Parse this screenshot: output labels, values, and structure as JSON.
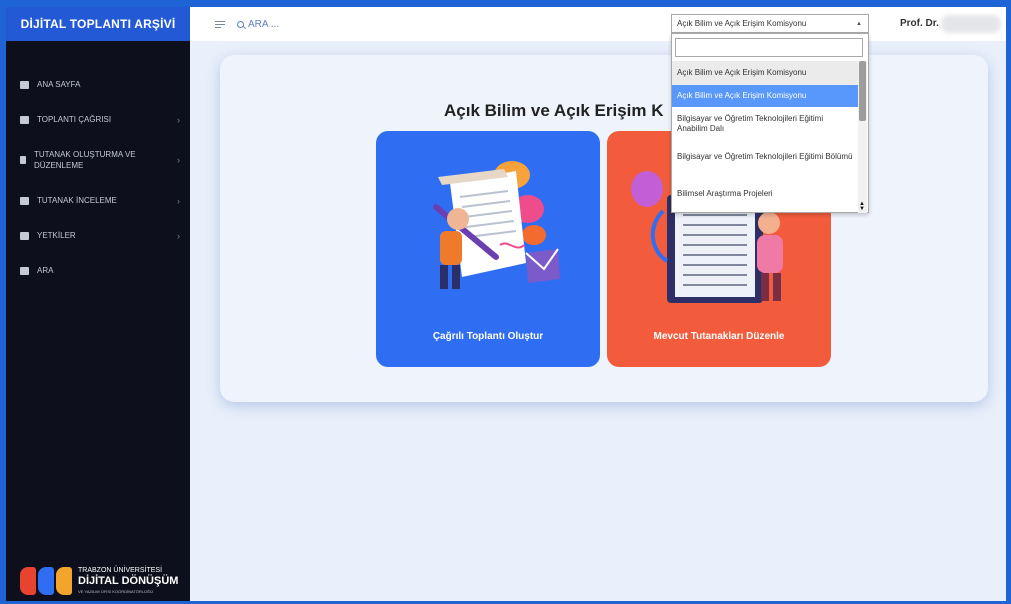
{
  "sidebar": {
    "brand": "DİJİTAL TOPLANTI ARŞİVİ",
    "items": [
      {
        "label": "ANA SAYFA",
        "icon": "dashboard-icon",
        "chevron": ""
      },
      {
        "label": "TOPLANTI ÇAĞRISI",
        "icon": "calendar-icon",
        "chevron": "›"
      },
      {
        "label": "TUTANAK OLUŞTURMA VE DÜZENLEME",
        "icon": "edit-icon",
        "chevron": "›"
      },
      {
        "label": "TUTANAK İNCELEME",
        "icon": "document-icon",
        "chevron": "›"
      },
      {
        "label": "YETKİLER",
        "icon": "id-card-icon",
        "chevron": "›"
      },
      {
        "label": "ARA",
        "icon": "search-list-icon",
        "chevron": ""
      }
    ],
    "logo": {
      "line1": "TRABZON ÜNİVERSİTESİ",
      "line2": "DİJİTAL DÖNÜŞÜM",
      "line3": "VE YAZILIM OFİSİ KOORDİNATÖRLÜĞÜ"
    }
  },
  "topbar": {
    "search_label": "ARA ...",
    "select_value": "Açık Bilim ve Açık Erişim Komisyonu",
    "select_arrow": "▲",
    "profile": "Prof. Dr."
  },
  "dropdown": {
    "options": [
      "Açık Bilim ve Açık Erişim Komisyonu",
      "Açık Bilim ve Açık Erişim Komisyonu",
      "Bilgisayar ve Öğretim Teknolojileri Eğitimi Anabilim Dalı",
      "Bilgisayar ve Öğretim Teknolojileri Eğitimi Bölümü",
      "Bilimsel Araştırma Projeleri"
    ]
  },
  "main": {
    "title": "Açık Bilim ve Açık Erişim K",
    "tiles": [
      {
        "label": "Çağrılı Toplantı Oluştur"
      },
      {
        "label": "Mevcut Tutanakları Düzenle"
      }
    ]
  },
  "colors": {
    "brand": "#2459d6",
    "sidebar": "#0d0f1c",
    "tile_blue": "#2f6ef2",
    "tile_red": "#f25c3c",
    "dropdown_highlight": "#5897fb"
  }
}
